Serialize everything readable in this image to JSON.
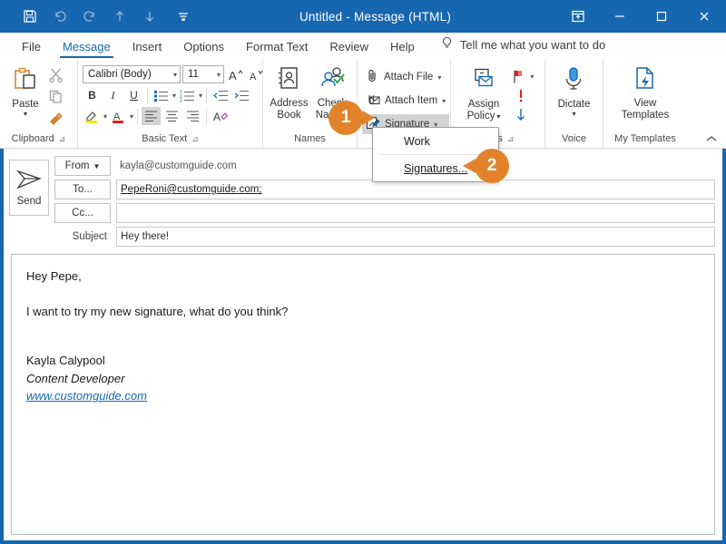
{
  "window": {
    "title": "Untitled  -  Message (HTML)",
    "accent_color": "#1767b0",
    "badge_color": "#e2832b"
  },
  "quick_access": {
    "items": [
      {
        "name": "save-icon",
        "label": "Save"
      },
      {
        "name": "undo-icon",
        "label": "Undo"
      },
      {
        "name": "redo-icon",
        "label": "Redo"
      },
      {
        "name": "previous-item-icon",
        "label": "Previous Item"
      },
      {
        "name": "next-item-icon",
        "label": "Next Item"
      },
      {
        "name": "customize-quick-access-icon",
        "label": "Customize Quick Access Toolbar"
      }
    ]
  },
  "window_controls": {
    "ribbon_display": "Ribbon Display Options",
    "minimize": "Minimize",
    "maximize": "Maximize",
    "close": "Close"
  },
  "tabs": [
    {
      "label": "File",
      "active": false
    },
    {
      "label": "Message",
      "active": true
    },
    {
      "label": "Insert",
      "active": false
    },
    {
      "label": "Options",
      "active": false
    },
    {
      "label": "Format Text",
      "active": false
    },
    {
      "label": "Review",
      "active": false
    },
    {
      "label": "Help",
      "active": false
    }
  ],
  "tell_me": "Tell me what you want to do",
  "ribbon": {
    "clipboard": {
      "label": "Clipboard",
      "paste": "Paste",
      "cut": "Cut",
      "copy": "Copy",
      "format_painter": "Format Painter"
    },
    "basic_text": {
      "label": "Basic Text",
      "font_name": "Calibri (Body)",
      "font_size": "11",
      "grow_font": "A",
      "shrink_font": "A",
      "bold": "B",
      "italic": "I",
      "underline": "U",
      "bullets": "Bullets",
      "numbering": "Numbering",
      "decrease_indent": "Decrease Indent",
      "increase_indent": "Increase Indent",
      "highlight": "Text Highlight Color",
      "font_color": "Font Color",
      "align_left": "Align Left",
      "align_center": "Center",
      "align_right": "Align Right",
      "clear_formatting": "Clear All Formatting"
    },
    "names": {
      "label": "Names",
      "address_book": "Address\nBook",
      "address_book_line1": "Address",
      "address_book_line2": "Book",
      "check_names_line1": "Check",
      "check_names_line2": "Names"
    },
    "include": {
      "attach_file": "Attach File",
      "attach_item": "Attach Item",
      "signature": "Signature"
    },
    "tags": {
      "label": "Tags",
      "assign_policy_line1": "Assign",
      "assign_policy_line2": "Policy",
      "follow_up": "Follow Up",
      "high_importance": "!",
      "low_importance": "Low Importance"
    },
    "voice": {
      "label": "Voice",
      "dictate": "Dictate"
    },
    "my_templates": {
      "label": "My Templates",
      "view_line1": "View",
      "view_line2": "Templates"
    },
    "collapse": "Collapse the Ribbon"
  },
  "signature_menu": {
    "items": [
      {
        "label": "Work",
        "underline_first": false
      },
      {
        "label": "Signatures...",
        "underline_first": true
      }
    ]
  },
  "badges": [
    {
      "number": "1",
      "direction": "right"
    },
    {
      "number": "2",
      "direction": "left"
    }
  ],
  "message": {
    "send_label": "Send",
    "from_label": "From",
    "from_value": "kayla@customguide.com",
    "to_label": "To...",
    "to_value": "PepeRoni@customguide.com;",
    "cc_label": "Cc...",
    "cc_value": "",
    "subject_label": "Subject",
    "subject_value": "Hey there!",
    "body": {
      "greeting": "Hey Pepe,",
      "paragraph": "I want to try my new signature, what do you think?",
      "signature_name": "Kayla Calypool",
      "signature_title": "Content Developer",
      "signature_url": "www.customguide.com"
    }
  }
}
